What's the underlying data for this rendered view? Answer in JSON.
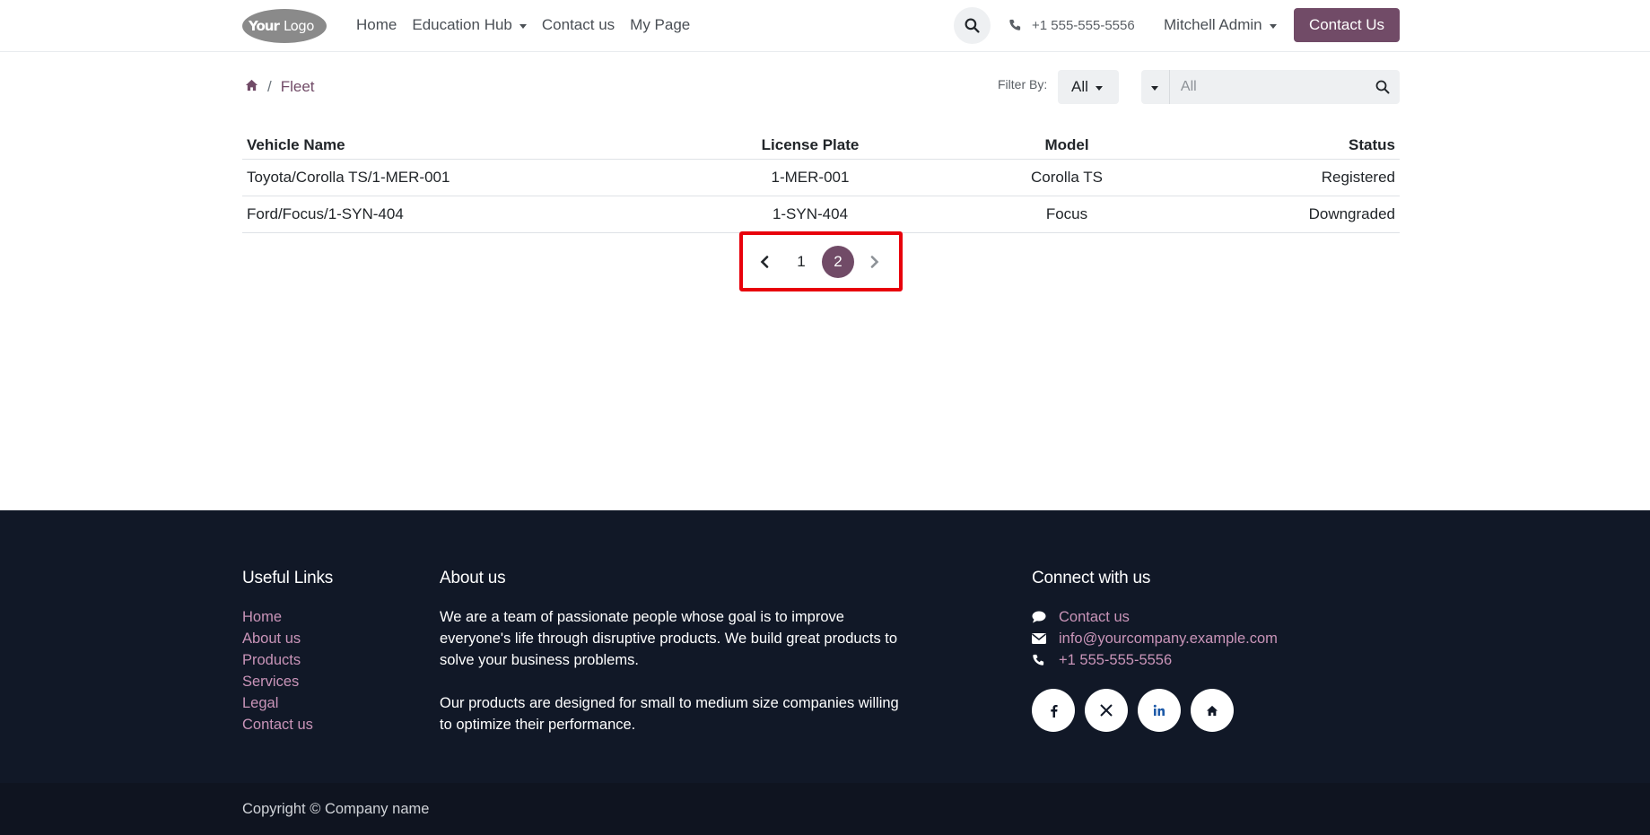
{
  "header": {
    "logo_alt": "YourLogo",
    "nav": [
      "Home",
      "Education Hub",
      "Contact us",
      "My Page"
    ],
    "phone": "+1 555-555-5556",
    "user": "Mitchell Admin",
    "cta": "Contact Us"
  },
  "breadcrumb": {
    "current": "Fleet"
  },
  "filter": {
    "label": "Filter By:",
    "value": "All",
    "search_placeholder": "All"
  },
  "table": {
    "headers": [
      "Vehicle Name",
      "License Plate",
      "Model",
      "Status"
    ],
    "rows": [
      [
        "Toyota/Corolla TS/1-MER-001",
        "1-MER-001",
        "Corolla TS",
        "Registered"
      ],
      [
        "Ford/Focus/1-SYN-404",
        "1-SYN-404",
        "Focus",
        "Downgraded"
      ]
    ]
  },
  "pagination": {
    "pages": [
      "1",
      "2"
    ],
    "current": "2"
  },
  "footer": {
    "links_title": "Useful Links",
    "links": [
      "Home",
      "About us",
      "Products",
      "Services",
      "Legal",
      "Contact us"
    ],
    "about_title": "About us",
    "about_p1": "We are a team of passionate people whose goal is to improve everyone's life through disruptive products. We build great products to solve your business problems.",
    "about_p2": "Our products are designed for small to medium size companies willing to optimize their performance.",
    "connect_title": "Connect with us",
    "connect_contact": "Contact us",
    "connect_email": "info@yourcompany.example.com",
    "connect_phone": "+1 555-555-5556",
    "socials": [
      "facebook-icon",
      "x-icon",
      "linkedin-icon",
      "home-icon"
    ],
    "copyright": "Copyright © Company name"
  },
  "colors": {
    "brand": "#714b67",
    "footer_bg": "#111827",
    "link": "#c994b8",
    "highlight": "#e8000b"
  }
}
